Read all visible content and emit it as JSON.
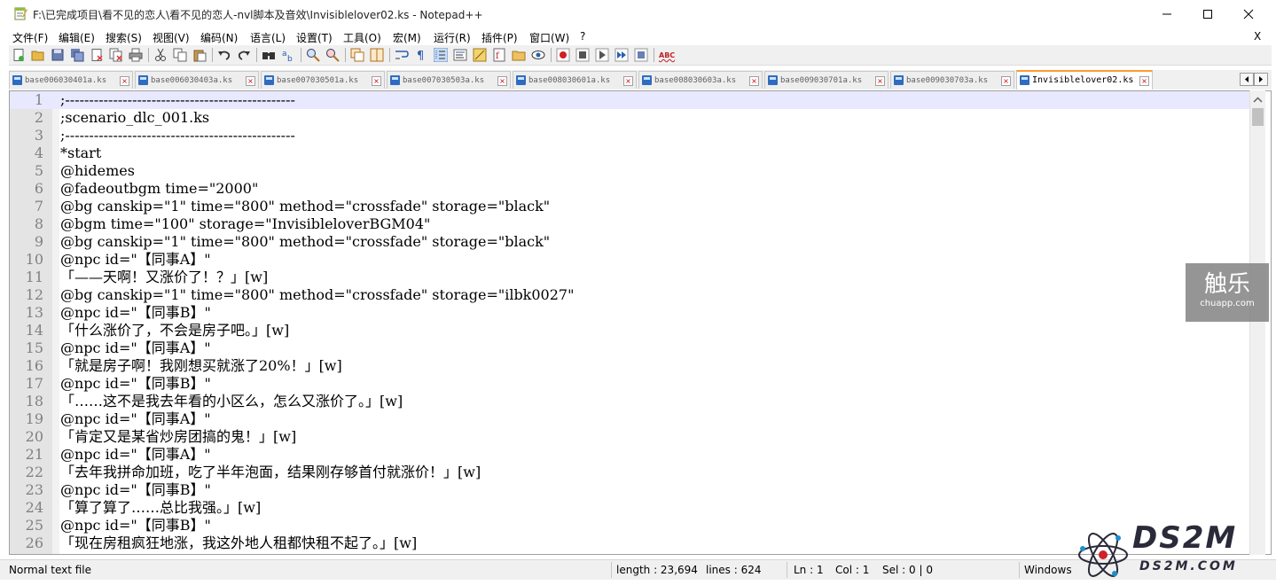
{
  "window": {
    "title": "F:\\已完成项目\\看不见的恋人\\看不见的恋人-nvl脚本及音效\\Invisiblelover02.ks - Notepad++",
    "close_doc_label": "X"
  },
  "menu": [
    "文件(F)",
    "编辑(E)",
    "搜索(S)",
    "视图(V)",
    "编码(N)",
    "语言(L)",
    "设置(T)",
    "工具(O)",
    "宏(M)",
    "运行(R)",
    "插件(P)",
    "窗口(W)",
    "?"
  ],
  "toolbar": {
    "spellcheck_label": "ABC"
  },
  "tabs": [
    {
      "label": "base006030401a.ks",
      "active": false
    },
    {
      "label": "base006030403a.ks",
      "active": false
    },
    {
      "label": "base007030501a.ks",
      "active": false
    },
    {
      "label": "base007030503a.ks",
      "active": false
    },
    {
      "label": "base008030601a.ks",
      "active": false
    },
    {
      "label": "base008030603a.ks",
      "active": false
    },
    {
      "label": "base009030701a.ks",
      "active": false
    },
    {
      "label": "base009030703a.ks",
      "active": false
    },
    {
      "label": "Invisiblelover02.ks",
      "active": true
    }
  ],
  "editor": {
    "lines": [
      {
        "n": "1",
        "text": ";------------------------------------------------"
      },
      {
        "n": "2",
        "text": ";scenario_dlc_001.ks"
      },
      {
        "n": "3",
        "text": ";------------------------------------------------"
      },
      {
        "n": "4",
        "text": "*start"
      },
      {
        "n": "5",
        "text": "@hidemes"
      },
      {
        "n": "6",
        "text": "@fadeoutbgm time=\"2000\""
      },
      {
        "n": "7",
        "text": "@bg canskip=\"1\" time=\"800\" method=\"crossfade\" storage=\"black\""
      },
      {
        "n": "8",
        "text": "@bgm time=\"100\" storage=\"InvisibleloverBGM04\""
      },
      {
        "n": "9",
        "text": "@bg canskip=\"1\" time=\"800\" method=\"crossfade\" storage=\"black\""
      },
      {
        "n": "10",
        "text": "@npc id=\"【同事A】\""
      },
      {
        "n": "11",
        "text": "「——天啊！又涨价了！？」[w]"
      },
      {
        "n": "12",
        "text": "@bg canskip=\"1\" time=\"800\" method=\"crossfade\" storage=\"ilbk0027\""
      },
      {
        "n": "13",
        "text": "@npc id=\"【同事B】\""
      },
      {
        "n": "14",
        "text": "「什么涨价了，不会是房子吧。」[w]"
      },
      {
        "n": "15",
        "text": "@npc id=\"【同事A】\""
      },
      {
        "n": "16",
        "text": "「就是房子啊！我刚想买就涨了20%！」[w]"
      },
      {
        "n": "17",
        "text": "@npc id=\"【同事B】\""
      },
      {
        "n": "18",
        "text": "「……这不是我去年看的小区么，怎么又涨价了。」[w]"
      },
      {
        "n": "19",
        "text": "@npc id=\"【同事A】\""
      },
      {
        "n": "20",
        "text": "「肯定又是某省炒房团搞的鬼！」[w]"
      },
      {
        "n": "21",
        "text": "@npc id=\"【同事A】\""
      },
      {
        "n": "22",
        "text": "「去年我拼命加班，吃了半年泡面，结果刚存够首付就涨价！」[w]"
      },
      {
        "n": "23",
        "text": "@npc id=\"【同事B】\""
      },
      {
        "n": "24",
        "text": "「算了算了……总比我强。」[w]"
      },
      {
        "n": "25",
        "text": "@npc id=\"【同事B】\""
      },
      {
        "n": "26",
        "text": "「现在房租疯狂地涨，我这外地人租都快租不起了。」[w]"
      }
    ]
  },
  "status": {
    "file_type": "Normal text file",
    "length": "length : 23,694",
    "lines": "lines : 624",
    "ln": "Ln : 1",
    "col": "Col : 1",
    "sel": "Sel : 0 | 0",
    "eol": "Windows"
  },
  "watermarks": {
    "chuapp_main": "触乐",
    "chuapp_sub": "chuapp.com",
    "ds2m_main": "DS2M",
    "ds2m_sub": "DS2M.COM"
  },
  "colors": {
    "current_line": "#e8e8ff",
    "active_tab_accent": "#fa9b32",
    "gutter": "#e4e4e4"
  }
}
